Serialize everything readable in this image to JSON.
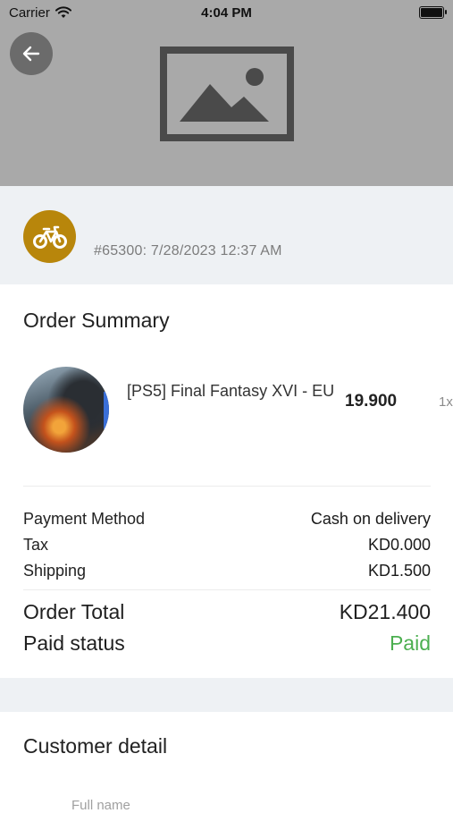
{
  "status_bar": {
    "carrier": "Carrier",
    "time": "4:04 PM",
    "battery_level": 1.0
  },
  "hero": {
    "image_icon": "image-placeholder-icon",
    "back_icon": "arrow-left-icon"
  },
  "order": {
    "delivery_icon": "bicycle-icon",
    "meta": "#65300: 7/28/2023 12:37 AM"
  },
  "summary": {
    "title": "Order Summary",
    "items": [
      {
        "name": "[PS5] Final Fantasy XVI - EU",
        "price": "19.900",
        "qty": "1x"
      }
    ],
    "payment_method_label": "Payment Method",
    "payment_method_value": "Cash on delivery",
    "tax_label": "Tax",
    "tax_value": "KD0.000",
    "shipping_label": "Shipping",
    "shipping_value": "KD1.500",
    "total_label": "Order Total",
    "total_value": "KD21.400",
    "paid_status_label": "Paid status",
    "paid_status_value": "Paid"
  },
  "customer": {
    "title": "Customer detail",
    "full_name_label": "Full name"
  },
  "colors": {
    "hero_bg": "#a9a9a9",
    "badge": "#b8860b",
    "paid": "#4caf50",
    "band": "#eef1f4"
  }
}
